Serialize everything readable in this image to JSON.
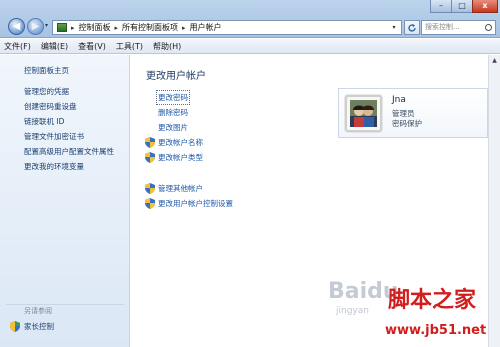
{
  "window": {
    "back_label": "◀",
    "forward_label": "▶",
    "min_label": "–",
    "max_label": "□",
    "close_label": "x"
  },
  "address": {
    "separator": "▸",
    "crumbs": [
      "控制面板",
      "所有控制面板项",
      "用户帐户"
    ],
    "dropdown": "▾"
  },
  "search": {
    "placeholder": "搜索控制..."
  },
  "menu": [
    "文件(F)",
    "编辑(E)",
    "查看(V)",
    "工具(T)",
    "帮助(H)"
  ],
  "left": {
    "home": "控制面板主页",
    "links": [
      "管理您的凭据",
      "创建密码重设盘",
      "链接联机 ID",
      "管理文件加密证书",
      "配置高级用户配置文件属性",
      "更改我的环境变量"
    ],
    "see_also": "另请参阅",
    "parental": "家长控制"
  },
  "main": {
    "title": "更改用户帐户",
    "tasks": [
      "更改密码",
      "删除密码",
      "更改图片",
      "更改帐户名称",
      "更改帐户类型"
    ],
    "other_tasks": [
      "管理其他帐户",
      "更改用户帐户控制设置"
    ]
  },
  "account": {
    "name": "Jna",
    "role": "管理员",
    "password_status": "密码保护"
  },
  "watermark": {
    "baidu": "Baidu",
    "jingyan": "jingyan",
    "site_cn": "脚本之家",
    "site_url": "www.jb51.net"
  },
  "colors": {
    "link": "#1e57a8",
    "title_text": "#1f3b66",
    "left_pane": "#dbe7f5",
    "watermark_red": "#d21d1d"
  }
}
